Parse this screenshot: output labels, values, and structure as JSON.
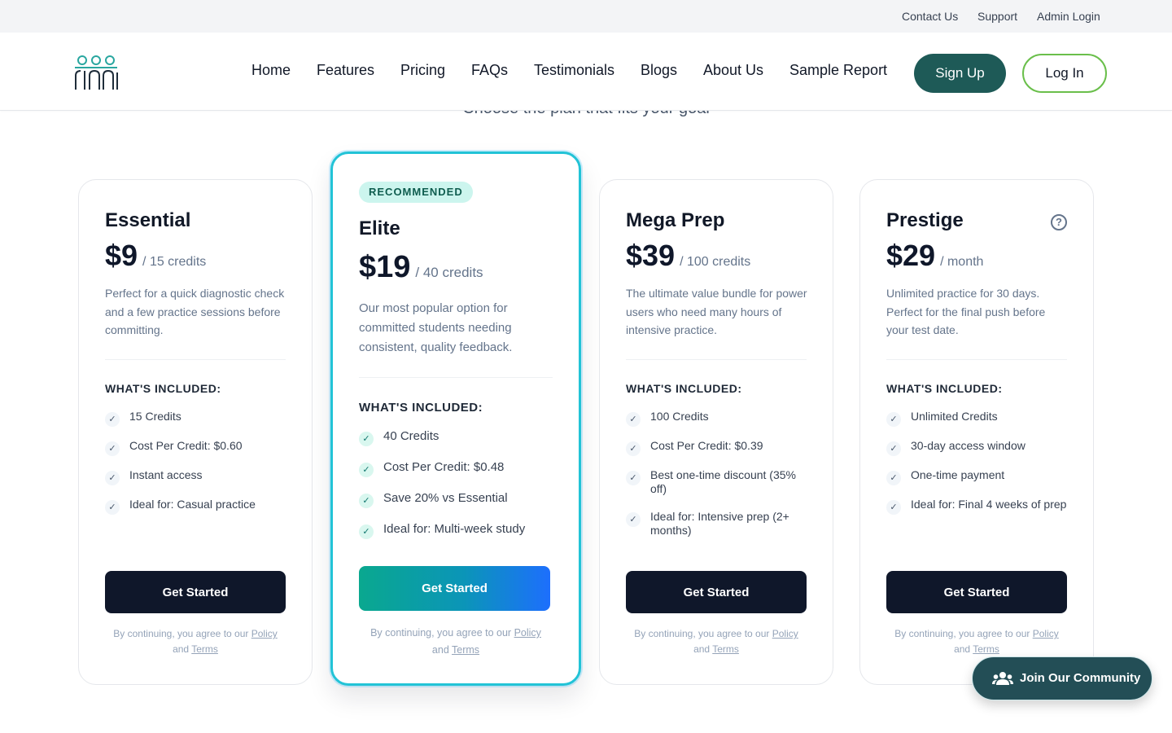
{
  "topbar": {
    "links": [
      "Contact Us",
      "Support",
      "Admin Login"
    ]
  },
  "nav": {
    "links": [
      "Home",
      "Features",
      "Pricing",
      "FAQs",
      "Testimonials",
      "Blogs",
      "About Us",
      "Sample Report"
    ],
    "signup": "Sign Up",
    "login": "Log In"
  },
  "subtitle": "Choose the plan that fits your goal",
  "plans": [
    {
      "name": "Essential",
      "price": "$9",
      "unit": "/ 15 credits",
      "description": "Perfect for a quick diagnostic check and a few practice sessions before committing.",
      "included_label": "WHAT'S INCLUDED:",
      "features": [
        "15 Credits",
        "Cost Per Credit: $0.60",
        "Instant access",
        "Ideal for: Casual practice"
      ],
      "cta": "Get Started",
      "legal": {
        "prefix": "By continuing, you agree to our",
        "policy": "Policy",
        "and": "and",
        "terms": "Terms"
      }
    },
    {
      "badge": "RECOMMENDED",
      "name": "Elite",
      "price": "$19",
      "unit": "/ 40 credits",
      "description": "Our most popular option for committed students needing consistent, quality feedback.",
      "included_label": "WHAT'S INCLUDED:",
      "features": [
        "40 Credits",
        "Cost Per Credit: $0.48",
        "Save 20% vs Essential",
        "Ideal for: Multi-week study"
      ],
      "cta": "Get Started",
      "legal": {
        "prefix": "By continuing, you agree to our",
        "policy": "Policy",
        "and": "and",
        "terms": "Terms"
      }
    },
    {
      "name": "Mega Prep",
      "price": "$39",
      "unit": "/ 100 credits",
      "description": "The ultimate value bundle for power users who need many hours of intensive practice.",
      "included_label": "WHAT'S INCLUDED:",
      "features": [
        "100 Credits",
        "Cost Per Credit: $0.39",
        "Best one-time discount (35% off)",
        "Ideal for: Intensive prep (2+ months)"
      ],
      "cta": "Get Started",
      "legal": {
        "prefix": "By continuing, you agree to our",
        "policy": "Policy",
        "and": "and",
        "terms": "Terms"
      }
    },
    {
      "name": "Prestige",
      "price": "$29",
      "unit": "/ month",
      "description": "Unlimited practice for 30 days. Perfect for the final push before your test date.",
      "included_label": "WHAT'S INCLUDED:",
      "features": [
        "Unlimited Credits",
        "30-day access window",
        "One-time payment",
        "Ideal for: Final 4 weeks of prep"
      ],
      "cta": "Get Started",
      "legal": {
        "prefix": "By continuing, you agree to our",
        "policy": "Policy",
        "and": "and",
        "terms": "Terms"
      }
    }
  ],
  "community_button": "Join Our Community"
}
